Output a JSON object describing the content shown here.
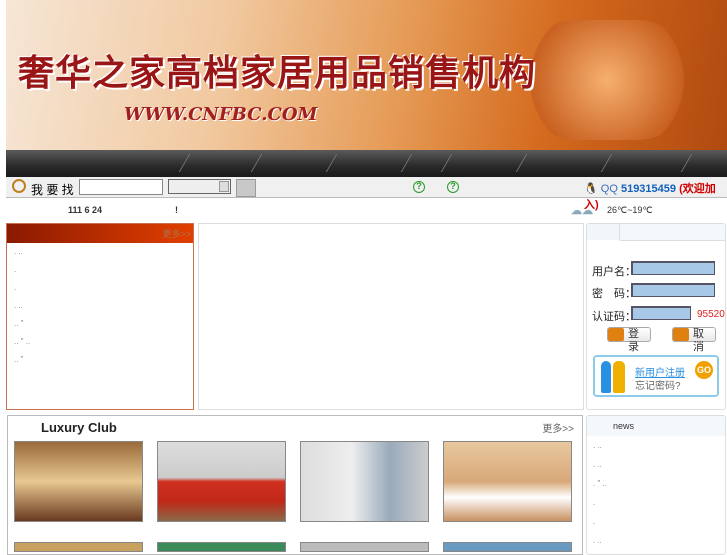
{
  "banner": {
    "title": "奢华之家高档家居用品销售机构",
    "url": "WWW.CNFBC.COM"
  },
  "search": {
    "label": "我 要 找",
    "input_value": "",
    "select_value": "",
    "help1": "?",
    "help2": "?"
  },
  "qq": {
    "label": "QQ",
    "number": "519315459",
    "join": "(欢迎加入)"
  },
  "info": {
    "date": "111 6 24",
    "exclaim": "!",
    "weather": "26℃~19℃"
  },
  "left_panel": {
    "more": "更多>>",
    "rows": [
      ".   ..",
      ".",
      ".",
      ".  ..",
      ".. \"",
      ".. \"  ..",
      ".. \""
    ]
  },
  "login": {
    "username_label": "用户名：",
    "password_label": "密　码：",
    "captcha_label": "认证码：",
    "captcha_code": "95520",
    "login_button": "登录",
    "cancel_button": "取消",
    "register": "新用户注册",
    "forgot": "忘记密码?",
    "go": "GO"
  },
  "club": {
    "title": "Luxury Club",
    "more": "更多>>",
    "images": [
      "古典卧室",
      "红色沙发客厅",
      "现代卧室",
      "木质卧室"
    ]
  },
  "news": {
    "title": "news",
    "rows": [
      ". ..",
      ". ..",
      ". \" ..",
      ".",
      ".",
      ". .."
    ]
  },
  "colors": {
    "accent": "#c03000",
    "qq_number": "#1060c0",
    "join": "#d00000",
    "captcha": "#e02020"
  }
}
